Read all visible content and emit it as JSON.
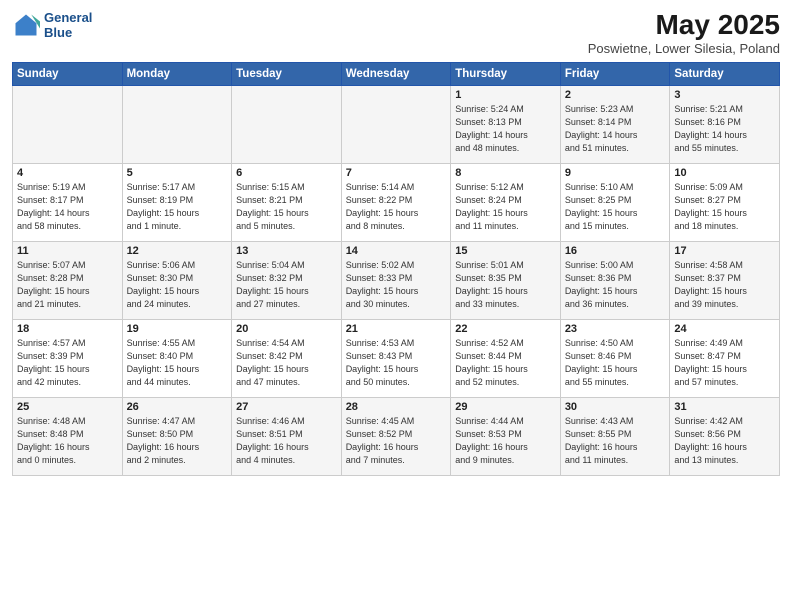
{
  "logo": {
    "line1": "General",
    "line2": "Blue"
  },
  "title": "May 2025",
  "location": "Poswietne, Lower Silesia, Poland",
  "weekdays": [
    "Sunday",
    "Monday",
    "Tuesday",
    "Wednesday",
    "Thursday",
    "Friday",
    "Saturday"
  ],
  "weeks": [
    [
      {
        "day": "",
        "info": ""
      },
      {
        "day": "",
        "info": ""
      },
      {
        "day": "",
        "info": ""
      },
      {
        "day": "",
        "info": ""
      },
      {
        "day": "1",
        "info": "Sunrise: 5:24 AM\nSunset: 8:13 PM\nDaylight: 14 hours\nand 48 minutes."
      },
      {
        "day": "2",
        "info": "Sunrise: 5:23 AM\nSunset: 8:14 PM\nDaylight: 14 hours\nand 51 minutes."
      },
      {
        "day": "3",
        "info": "Sunrise: 5:21 AM\nSunset: 8:16 PM\nDaylight: 14 hours\nand 55 minutes."
      }
    ],
    [
      {
        "day": "4",
        "info": "Sunrise: 5:19 AM\nSunset: 8:17 PM\nDaylight: 14 hours\nand 58 minutes."
      },
      {
        "day": "5",
        "info": "Sunrise: 5:17 AM\nSunset: 8:19 PM\nDaylight: 15 hours\nand 1 minute."
      },
      {
        "day": "6",
        "info": "Sunrise: 5:15 AM\nSunset: 8:21 PM\nDaylight: 15 hours\nand 5 minutes."
      },
      {
        "day": "7",
        "info": "Sunrise: 5:14 AM\nSunset: 8:22 PM\nDaylight: 15 hours\nand 8 minutes."
      },
      {
        "day": "8",
        "info": "Sunrise: 5:12 AM\nSunset: 8:24 PM\nDaylight: 15 hours\nand 11 minutes."
      },
      {
        "day": "9",
        "info": "Sunrise: 5:10 AM\nSunset: 8:25 PM\nDaylight: 15 hours\nand 15 minutes."
      },
      {
        "day": "10",
        "info": "Sunrise: 5:09 AM\nSunset: 8:27 PM\nDaylight: 15 hours\nand 18 minutes."
      }
    ],
    [
      {
        "day": "11",
        "info": "Sunrise: 5:07 AM\nSunset: 8:28 PM\nDaylight: 15 hours\nand 21 minutes."
      },
      {
        "day": "12",
        "info": "Sunrise: 5:06 AM\nSunset: 8:30 PM\nDaylight: 15 hours\nand 24 minutes."
      },
      {
        "day": "13",
        "info": "Sunrise: 5:04 AM\nSunset: 8:32 PM\nDaylight: 15 hours\nand 27 minutes."
      },
      {
        "day": "14",
        "info": "Sunrise: 5:02 AM\nSunset: 8:33 PM\nDaylight: 15 hours\nand 30 minutes."
      },
      {
        "day": "15",
        "info": "Sunrise: 5:01 AM\nSunset: 8:35 PM\nDaylight: 15 hours\nand 33 minutes."
      },
      {
        "day": "16",
        "info": "Sunrise: 5:00 AM\nSunset: 8:36 PM\nDaylight: 15 hours\nand 36 minutes."
      },
      {
        "day": "17",
        "info": "Sunrise: 4:58 AM\nSunset: 8:37 PM\nDaylight: 15 hours\nand 39 minutes."
      }
    ],
    [
      {
        "day": "18",
        "info": "Sunrise: 4:57 AM\nSunset: 8:39 PM\nDaylight: 15 hours\nand 42 minutes."
      },
      {
        "day": "19",
        "info": "Sunrise: 4:55 AM\nSunset: 8:40 PM\nDaylight: 15 hours\nand 44 minutes."
      },
      {
        "day": "20",
        "info": "Sunrise: 4:54 AM\nSunset: 8:42 PM\nDaylight: 15 hours\nand 47 minutes."
      },
      {
        "day": "21",
        "info": "Sunrise: 4:53 AM\nSunset: 8:43 PM\nDaylight: 15 hours\nand 50 minutes."
      },
      {
        "day": "22",
        "info": "Sunrise: 4:52 AM\nSunset: 8:44 PM\nDaylight: 15 hours\nand 52 minutes."
      },
      {
        "day": "23",
        "info": "Sunrise: 4:50 AM\nSunset: 8:46 PM\nDaylight: 15 hours\nand 55 minutes."
      },
      {
        "day": "24",
        "info": "Sunrise: 4:49 AM\nSunset: 8:47 PM\nDaylight: 15 hours\nand 57 minutes."
      }
    ],
    [
      {
        "day": "25",
        "info": "Sunrise: 4:48 AM\nSunset: 8:48 PM\nDaylight: 16 hours\nand 0 minutes."
      },
      {
        "day": "26",
        "info": "Sunrise: 4:47 AM\nSunset: 8:50 PM\nDaylight: 16 hours\nand 2 minutes."
      },
      {
        "day": "27",
        "info": "Sunrise: 4:46 AM\nSunset: 8:51 PM\nDaylight: 16 hours\nand 4 minutes."
      },
      {
        "day": "28",
        "info": "Sunrise: 4:45 AM\nSunset: 8:52 PM\nDaylight: 16 hours\nand 7 minutes."
      },
      {
        "day": "29",
        "info": "Sunrise: 4:44 AM\nSunset: 8:53 PM\nDaylight: 16 hours\nand 9 minutes."
      },
      {
        "day": "30",
        "info": "Sunrise: 4:43 AM\nSunset: 8:55 PM\nDaylight: 16 hours\nand 11 minutes."
      },
      {
        "day": "31",
        "info": "Sunrise: 4:42 AM\nSunset: 8:56 PM\nDaylight: 16 hours\nand 13 minutes."
      }
    ]
  ]
}
